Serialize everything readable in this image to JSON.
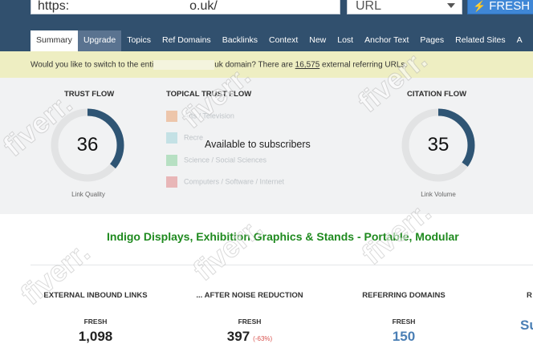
{
  "search": {
    "url_prefix": "https:",
    "url_suffix": "o.uk/",
    "type_selected": "URL",
    "fresh_label": "FRESH"
  },
  "tabs": [
    "Summary",
    "Upgrade",
    "Topics",
    "Ref Domains",
    "Backlinks",
    "Context",
    "New",
    "Lost",
    "Anchor Text",
    "Pages",
    "Related Sites",
    "A"
  ],
  "notice": {
    "before": "Would you like to switch to the enti",
    "middle": "uk domain? There are ",
    "count": "16,575",
    "after": " external referring URLs."
  },
  "trust_flow": {
    "title": "TRUST FLOW",
    "value": "36",
    "level": 36,
    "sublabel": "Link Quality",
    "color": "#2f5574"
  },
  "topical": {
    "title": "TOPICAL TRUST FLOW",
    "overlay": "Available to subscribers",
    "items": [
      {
        "label": "Arts / Television",
        "color": "#e9a36f"
      },
      {
        "label": "Recre",
        "color": "#9fd3d9"
      },
      {
        "label": "Science / Social Sciences",
        "color": "#86d29a"
      },
      {
        "label": "Computers / Software / Internet",
        "color": "#e08585"
      }
    ]
  },
  "citation_flow": {
    "title": "CITATION FLOW",
    "value": "35",
    "level": 35,
    "sublabel": "Link Volume",
    "color": "#2f5574"
  },
  "site_title": "Indigo Displays, Exhibition Graphics & Stands - Portable, Modular",
  "stats": [
    {
      "label": "EXTERNAL INBOUND LINKS",
      "fresh": "FRESH",
      "value": "1,098",
      "change": ""
    },
    {
      "label": "... AFTER NOISE REDUCTION",
      "fresh": "FRESH",
      "value": "397",
      "change": "(-63%)"
    },
    {
      "label": "REFERRING DOMAINS",
      "fresh": "FRESH",
      "value": "150",
      "change": ""
    },
    {
      "label": "R",
      "fresh": "",
      "value": "Su",
      "change": ""
    }
  ],
  "watermark": "fiverr."
}
